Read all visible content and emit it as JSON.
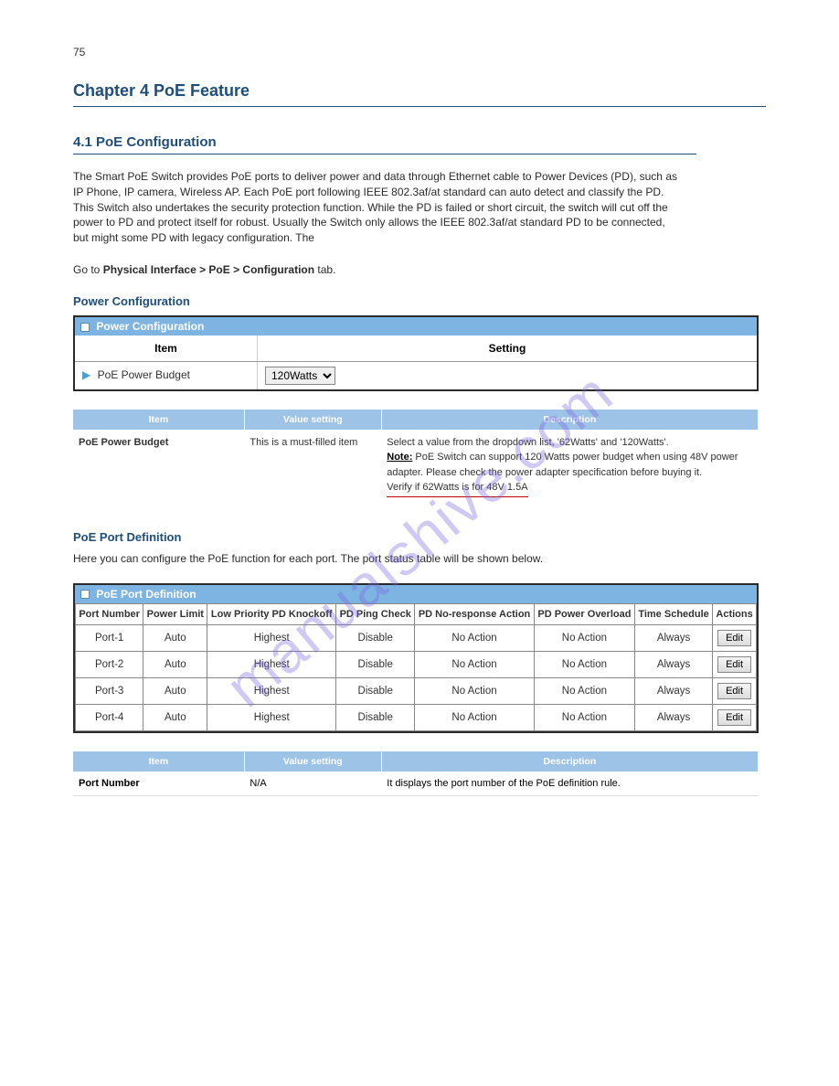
{
  "page_number": "75",
  "chapter": {
    "title": "Chapter 4 PoE Feature"
  },
  "section": {
    "title": "4.1 PoE Configuration",
    "intro": "The Smart PoE Switch provides PoE ports to deliver power and data through Ethernet cable to Power Devices (PD), such as IP Phone, IP camera, Wireless AP. Each PoE port following IEEE 802.3af/at standard can auto detect and classify the PD. This Switch also undertakes the security protection function. While the PD is failed or short circuit, the switch will cut off the power to PD and protect itself for robust. Usually the Switch only allows the IEEE 802.3af/at standard PD to be connected, but might some PD with legacy configuration. The",
    "intro2_prefix": "Go to ",
    "intro2_em": "Physical Interface > PoE > Configuration",
    "intro2_suffix": " tab."
  },
  "power_config": {
    "panel_title": "Power Configuration",
    "header_item": "Item",
    "header_setting": "Setting",
    "row_label": "PoE Power Budget",
    "select_value": "120Watts"
  },
  "cfg": {
    "headers": [
      "Item",
      "Value setting",
      "Description"
    ],
    "row": {
      "item": "PoE Power Budget",
      "value": "This is a must-filled item",
      "desc_line1": "Select a value from the dropdown list, '62Watts' and '120Watts'.",
      "desc_note_label": "Note:",
      "desc_note_text": " PoE Switch can support 120 Watts power budget when using 48V power adapter. Please check the power adapter specification before buying it.",
      "desc_red": "Verify if 62Watts is for 48V 1.5A"
    }
  },
  "port_def": {
    "panel_title": "PoE Port Definition",
    "headers": [
      "Port Number",
      "Power Limit",
      "Low Priority PD Knockoff",
      "PD Ping Check",
      "PD No-response Action",
      "PD Power Overload",
      "Time Schedule",
      "Actions"
    ],
    "edit_label": "Edit",
    "rows": [
      {
        "port": "Port-1",
        "power_limit": "Auto",
        "knockoff": "Highest",
        "ping": "Disable",
        "noresp": "No Action",
        "overload": "No Action",
        "schedule": "Always"
      },
      {
        "port": "Port-2",
        "power_limit": "Auto",
        "knockoff": "Highest",
        "ping": "Disable",
        "noresp": "No Action",
        "overload": "No Action",
        "schedule": "Always"
      },
      {
        "port": "Port-3",
        "power_limit": "Auto",
        "knockoff": "Highest",
        "ping": "Disable",
        "noresp": "No Action",
        "overload": "No Action",
        "schedule": "Always"
      },
      {
        "port": "Port-4",
        "power_limit": "Auto",
        "knockoff": "Highest",
        "ping": "Disable",
        "noresp": "No Action",
        "overload": "No Action",
        "schedule": "Always"
      }
    ]
  },
  "cfg2": {
    "headers": [
      "Item",
      "Value setting",
      "Description"
    ],
    "row_item": "Port Number",
    "row_value": "N/A",
    "row_desc": "It displays the port number of the PoE definition rule."
  },
  "watermark": "manualshive.com"
}
